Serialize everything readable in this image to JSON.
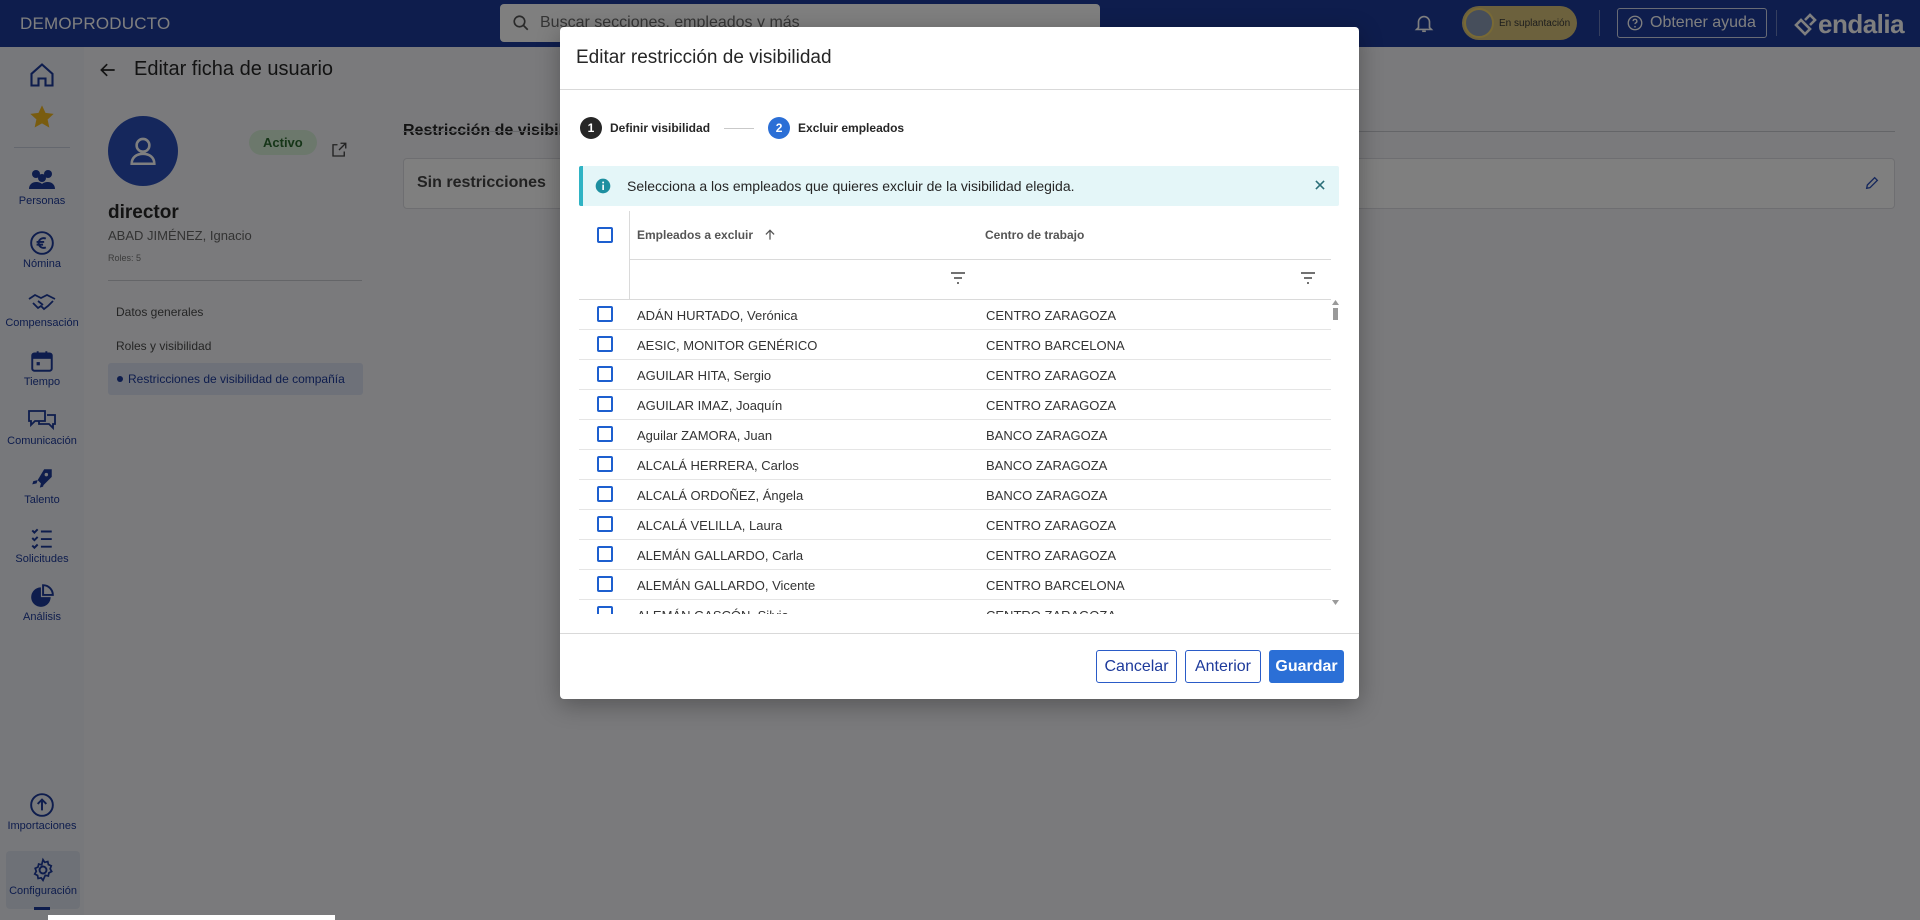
{
  "topbar": {
    "brand": "DEMOPRODUCTO",
    "search_placeholder": "Buscar secciones, empleados y más",
    "impersonation": "En suplantación",
    "help": "Obtener ayuda",
    "logo": "endalia"
  },
  "sidebar": {
    "items": [
      {
        "label": "Personas"
      },
      {
        "label": "Nómina"
      },
      {
        "label": "Compensación"
      },
      {
        "label": "Tiempo"
      },
      {
        "label": "Comunicación"
      },
      {
        "label": "Talento"
      },
      {
        "label": "Solicitudes"
      },
      {
        "label": "Análisis"
      },
      {
        "label": "Importaciones"
      },
      {
        "label": "Configuración"
      }
    ]
  },
  "page": {
    "title": "Editar ficha de usuario",
    "status": "Activo",
    "user_name": "director",
    "full_name": "ABAD JIMÉNEZ, Ignacio",
    "roles": "Roles: 5",
    "menu": [
      "Datos generales",
      "Roles y visibilidad",
      "Restricciones de visibilidad de compañía"
    ],
    "section_title": "Restricción de visibilidad",
    "card_text": "Sin restricciones"
  },
  "modal": {
    "title": "Editar restricción de visibilidad",
    "steps": [
      {
        "number": "1",
        "label": "Definir visibilidad"
      },
      {
        "number": "2",
        "label": "Excluir empleados"
      }
    ],
    "alert": "Selecciona a los empleados que quieres excluir de la visibilidad elegida.",
    "columns": [
      "Empleados a excluir",
      "Centro de trabajo"
    ],
    "rows": [
      {
        "name": "ADÁN HURTADO, Verónica",
        "center": "CENTRO ZARAGOZA"
      },
      {
        "name": "AESIC, MONITOR GENÉRICO",
        "center": "CENTRO BARCELONA"
      },
      {
        "name": "AGUILAR HITA, Sergio",
        "center": "CENTRO ZARAGOZA"
      },
      {
        "name": "AGUILAR IMAZ, Joaquín",
        "center": "CENTRO ZARAGOZA"
      },
      {
        "name": "Aguilar ZAMORA, Juan",
        "center": "BANCO ZARAGOZA"
      },
      {
        "name": "ALCALÁ HERRERA, Carlos",
        "center": "BANCO ZARAGOZA"
      },
      {
        "name": "ALCALÁ ORDOÑEZ, Ángela",
        "center": "BANCO ZARAGOZA"
      },
      {
        "name": "ALCALÁ VELILLA, Laura",
        "center": "CENTRO ZARAGOZA"
      },
      {
        "name": "ALEMÁN GALLARDO, Carla",
        "center": "CENTRO ZARAGOZA"
      },
      {
        "name": "ALEMÁN GALLARDO, Vicente",
        "center": "CENTRO BARCELONA"
      },
      {
        "name": "ALEMÁN GASCÓN, Silvia",
        "center": "CENTRO ZARAGOZA"
      }
    ],
    "buttons": {
      "cancel": "Cancelar",
      "previous": "Anterior",
      "save": "Guardar"
    }
  },
  "colors": {
    "topbar": "#1d3a9b",
    "primary": "#2b6fd6",
    "step_done": "#262626",
    "step_active": "#2b6fd6",
    "info": "#2fb3c4"
  }
}
